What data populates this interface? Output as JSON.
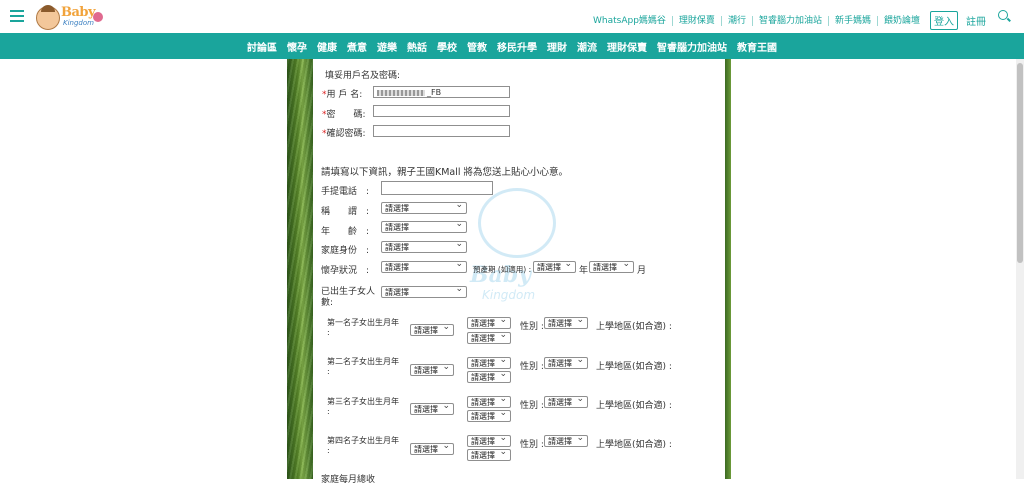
{
  "header": {
    "logo_text": "Baby",
    "logo_sub": "Kingdom",
    "links": [
      "WhatsApp媽媽谷",
      "理財保賣",
      "潮行",
      "智睿腦力加油站",
      "新手媽媽",
      "餵奶論壇"
    ],
    "login": "登入",
    "register": "註冊"
  },
  "nav": [
    "討論區",
    "懷孕",
    "健康",
    "煮意",
    "遊樂",
    "熱話",
    "學校",
    "管教",
    "移民升學",
    "理財",
    "潮流",
    "理財保賣",
    "智睿腦力加油站",
    "教育王國"
  ],
  "form": {
    "section1_title": "填妥用戶名及密碼:",
    "username_label": "用 戶 名:",
    "username_value": "_FB",
    "password_label": "密　　碼:",
    "confirm_label": "確認密碼:",
    "section2_title": "請填寫以下資訊，親子王國KMall 將為您送上貼心小心意。",
    "mobile_label": "手提電話　:",
    "title_label": "稱　　謂　:",
    "age_label": "年　　齡　:",
    "family_label": "家庭身份　:",
    "pregnancy_label": "懷孕狀況　:",
    "due_label": "預產期 (如適用) :",
    "year_suffix": "年",
    "month_suffix": "月",
    "children_label_1": "已出生子女人",
    "children_label_2": "數:",
    "select_placeholder": "請選擇",
    "child_rows": [
      {
        "label": "第一名子女出生月年",
        "colon": ":"
      },
      {
        "label": "第二名子女出生月年",
        "colon": ":"
      },
      {
        "label": "第三名子女出生月年",
        "colon": ":"
      },
      {
        "label": "第四名子女出生月年",
        "colon": ":"
      }
    ],
    "gender_label": "性別 :",
    "school_label": "上學地區(如合適) :",
    "more_label": "家庭每月總收"
  },
  "watermark": {
    "text": "Baby",
    "sub": "Kingdom"
  }
}
